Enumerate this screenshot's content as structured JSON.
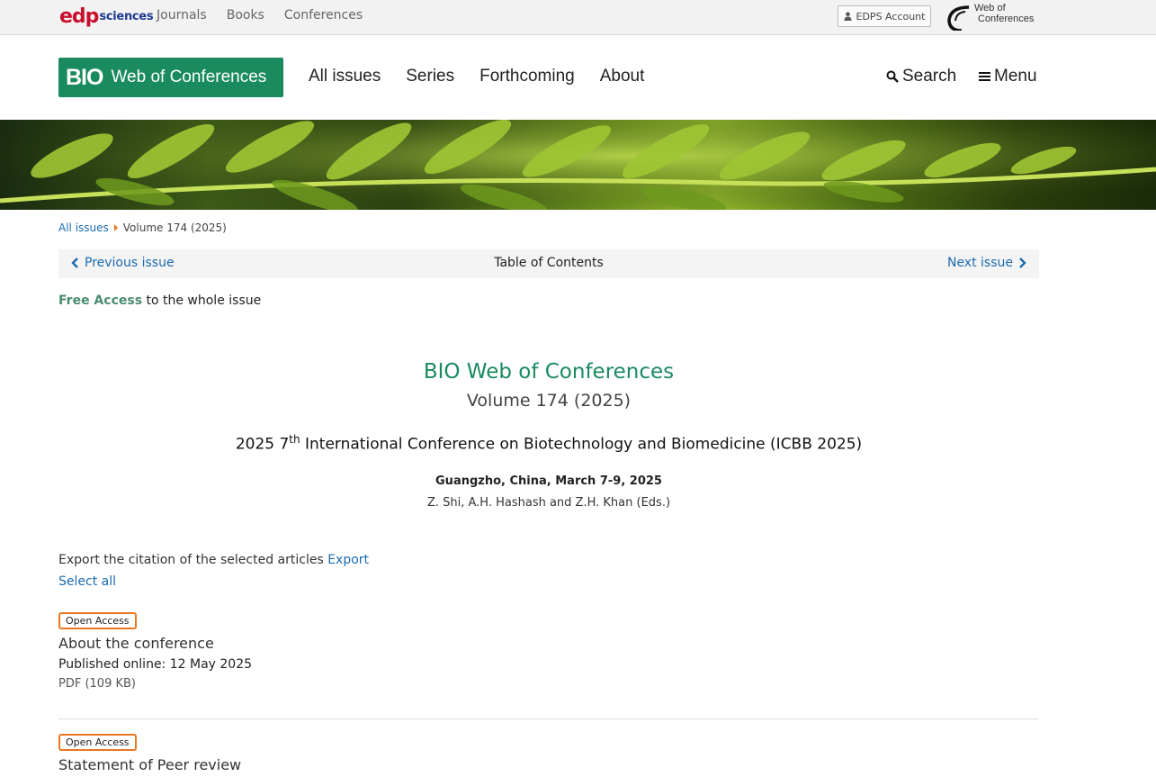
{
  "topbar": {
    "logo_edp": "edp",
    "logo_sciences": "sciences",
    "nav": [
      "Journals",
      "Books",
      "Conferences"
    ],
    "account_label": "EDPS Account",
    "woc_logo_line1": "Web of",
    "woc_logo_line2": "Conferences"
  },
  "header": {
    "brand_bio": "BIO",
    "brand_rest": "Web of Conferences",
    "nav": [
      "All issues",
      "Series",
      "Forthcoming",
      "About"
    ],
    "search_label": "Search",
    "menu_label": "Menu"
  },
  "breadcrumb": {
    "link": "All issues",
    "current": "Volume 174 (2025)"
  },
  "issue_nav": {
    "prev": "Previous issue",
    "center": "Table of Contents",
    "next": "Next issue"
  },
  "free_access": {
    "label": "Free Access",
    "rest": "to the whole issue"
  },
  "volume": {
    "journal": "BIO Web of Conferences",
    "volume": "Volume 174 (2025)",
    "conf_pre": "2025 7",
    "conf_sup": "th",
    "conf_post": " International Conference on Biotechnology and Biomedicine (ICBB 2025)",
    "place": "Guangzho, China, March 7-9, 2025",
    "editors": "Z. Shi, A.H. Hashash and Z.H. Khan (Eds.)"
  },
  "export": {
    "text": "Export the citation of the selected articles ",
    "link": "Export",
    "select_all": "Select all"
  },
  "articles": [
    {
      "badge": "Open Access",
      "title": "About the conference",
      "published": "Published online: 12 May 2025",
      "pdf": "PDF (109 KB)"
    },
    {
      "badge": "Open Access",
      "title": "Statement of Peer review"
    }
  ],
  "colors": {
    "brand_green": "#1a8a5f",
    "link_blue": "#1b6bb0",
    "badge_orange": "#e87722"
  }
}
